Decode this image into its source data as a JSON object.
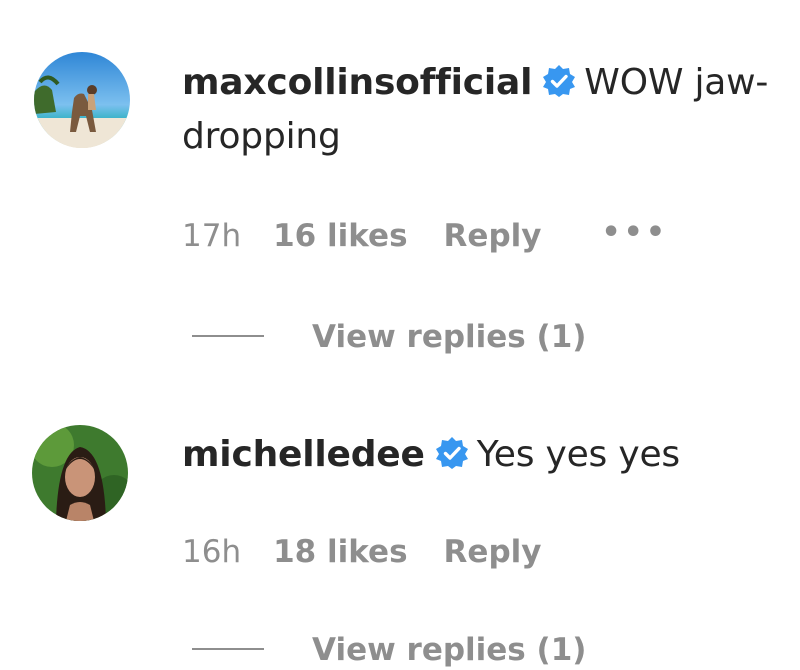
{
  "comments": [
    {
      "username": "maxcollinsofficial",
      "body_line1": "WOW jaw-",
      "body_line2": "dropping",
      "time": "17h",
      "likes": "16 likes",
      "reply_label": "Reply",
      "more_label": "•••",
      "view_replies": "View replies (1)",
      "avatar_icon": "beach-photo-avatar",
      "verified_icon": "verified-badge-icon"
    },
    {
      "username": "michelledee",
      "body_line1": "Yes yes yes",
      "time": "16h",
      "likes": "18 likes",
      "reply_label": "Reply",
      "view_replies": "View replies (1)",
      "avatar_icon": "portrait-photo-avatar",
      "verified_icon": "verified-badge-icon"
    }
  ],
  "colors": {
    "text_primary": "#262626",
    "text_secondary": "#8e8e8e",
    "verified_blue": "#3897f0"
  }
}
